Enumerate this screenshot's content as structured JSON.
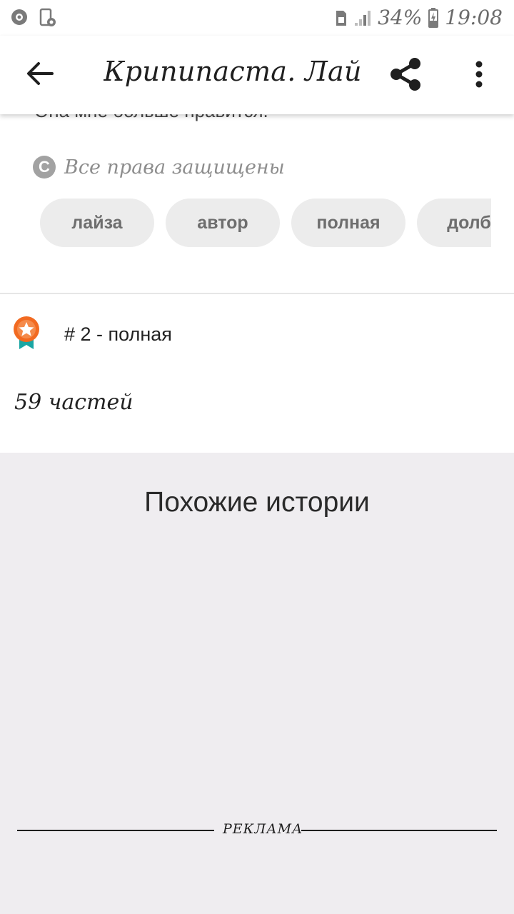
{
  "status_bar": {
    "battery_percent": "34%",
    "time": "19:08",
    "icons": [
      "shield-app-icon",
      "phone-cast-icon",
      "sim-icon",
      "signal-icon",
      "battery-charging-icon"
    ]
  },
  "app_bar": {
    "title": "Крипипаста. Лайз...",
    "icons": [
      "back-arrow-icon",
      "share-icon",
      "more-vert-icon"
    ]
  },
  "story": {
    "cut_text": "Она мне больше нравится.",
    "copyright": "Все права защищены",
    "tags": [
      "лайза",
      "автор",
      "полная",
      "долба"
    ],
    "rank": "# 2 - полная",
    "parts": "59 частей"
  },
  "similar": {
    "title": "Похожие истории",
    "ad_label": "РЕКЛАМА"
  },
  "colors": {
    "rank_badge": "#f26a21",
    "rank_ribbon": "#1aa6a4",
    "tag_bg": "#ececec",
    "similar_bg": "#efedf0"
  }
}
